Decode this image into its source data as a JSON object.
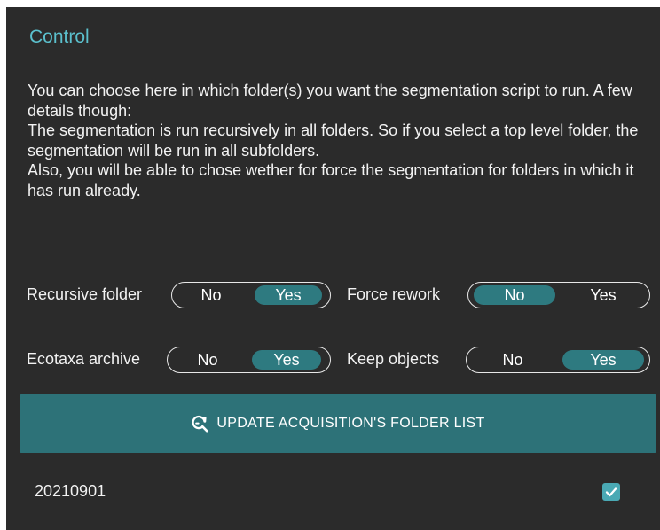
{
  "panel": {
    "title": "Control",
    "description": [
      "You can choose here in which folder(s) you want the segmentation script to run. A few details though:",
      "The segmentation is run recursively in all folders. So if you select a top level folder, the segmentation will be run in all subfolders.",
      "Also, you will be able to chose wether for force the segmentation for folders in which it has run already."
    ]
  },
  "options": {
    "recursive_folder": {
      "label": "Recursive folder",
      "no": "No",
      "yes": "Yes",
      "selected": "Yes"
    },
    "force_rework": {
      "label": "Force rework",
      "no": "No",
      "yes": "Yes",
      "selected": "No"
    },
    "ecotaxa_archive": {
      "label": "Ecotaxa archive",
      "no": "No",
      "yes": "Yes",
      "selected": "Yes"
    },
    "keep_objects": {
      "label": "Keep objects",
      "no": "No",
      "yes": "Yes",
      "selected": "Yes"
    }
  },
  "update_button": {
    "label": "UPDATE ACQUISITION'S FOLDER LIST",
    "icon": "refresh-search-icon"
  },
  "folders": [
    {
      "name": "20210901",
      "checked": true
    }
  ],
  "colors": {
    "panel_bg": "#2b2b2b",
    "title": "#5bc0cd",
    "accent": "#2e7a80",
    "button": "#2d7278",
    "checkbox": "#4aa9b4"
  }
}
